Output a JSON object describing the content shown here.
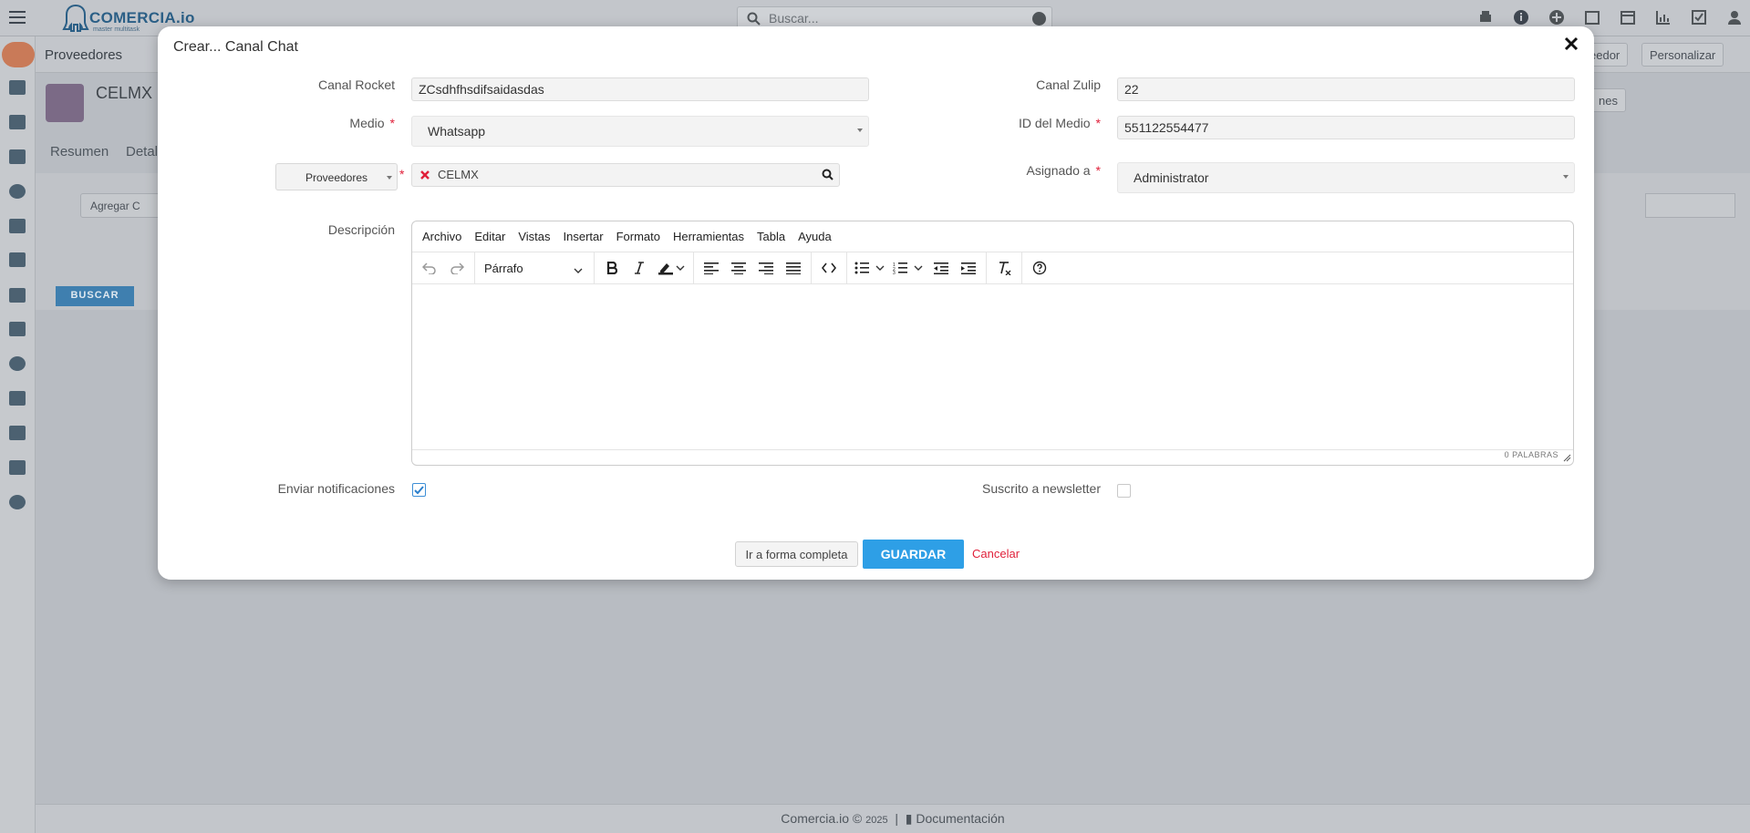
{
  "app": {
    "logo_text": "COMERCIA.io",
    "logo_tagline": "master multitask",
    "search_placeholder": "Buscar...",
    "breadcrumb": "Proveedores",
    "record_name": "CELMX",
    "tabs": [
      "Resumen",
      "Detal"
    ],
    "add_button": "Agregar C",
    "buscar_button": "BUSCAR",
    "right_buttons": {
      "proveedor": "eedor",
      "personalizar": "Personalizar",
      "acciones": "nes"
    },
    "footer": {
      "brand": "Comercia.io",
      "copyright": "©",
      "year": "2025",
      "separator": "|",
      "docs": "Documentación"
    }
  },
  "modal": {
    "title": "Crear... Canal Chat",
    "fields": {
      "canal_rocket": {
        "label": "Canal Rocket",
        "value": "ZCsdhfhsdifsaidasdas"
      },
      "canal_zulip": {
        "label": "Canal Zulip",
        "value": "22"
      },
      "medio": {
        "label": "Medio",
        "value": "Whatsapp"
      },
      "id_medio": {
        "label": "ID del Medio",
        "value": "551122554477"
      },
      "relacion": {
        "type": "Proveedores",
        "value": "CELMX"
      },
      "asignado": {
        "label": "Asignado a",
        "value": "Administrator"
      },
      "descripcion": {
        "label": "Descripción",
        "value": ""
      },
      "enviar_notificaciones": {
        "label": "Enviar notificaciones",
        "checked": true
      },
      "suscrito_newsletter": {
        "label": "Suscrito a newsletter",
        "checked": false
      }
    },
    "required_mark": "*",
    "editor": {
      "menu": [
        "Archivo",
        "Editar",
        "Vistas",
        "Insertar",
        "Formato",
        "Herramientas",
        "Tabla",
        "Ayuda"
      ],
      "block_format": "Párrafo",
      "word_count": "0 PALABRAS"
    },
    "buttons": {
      "full_form": "Ir a forma completa",
      "save": "GUARDAR",
      "cancel": "Cancelar"
    }
  },
  "colors": {
    "primary": "#2e9fe6",
    "danger": "#e0203a",
    "overlay": "#b8bcc2"
  }
}
